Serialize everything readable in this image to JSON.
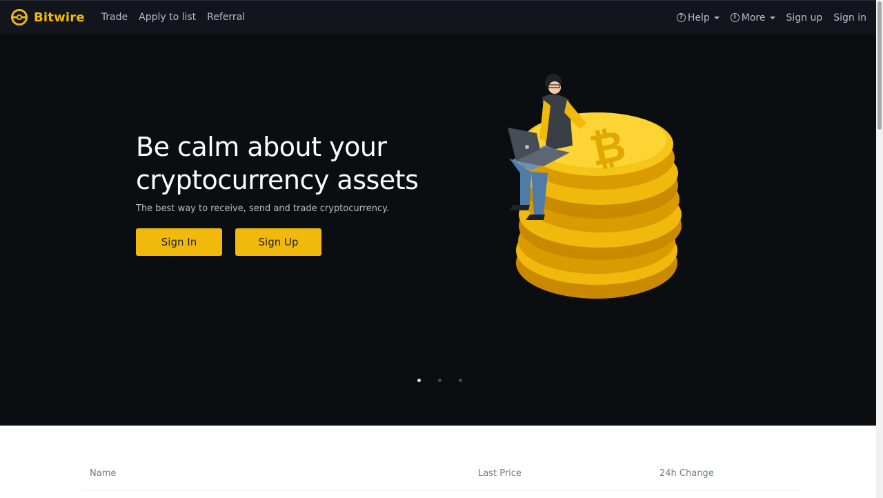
{
  "brand": {
    "name": "Bitwire",
    "accent_color": "#f0b90b"
  },
  "nav": {
    "left": [
      "Trade",
      "Apply to list",
      "Referral"
    ],
    "help": {
      "icon": "question-circle-icon",
      "label": "Help"
    },
    "more": {
      "icon": "info-circle-icon",
      "label": "More"
    },
    "signup": "Sign up",
    "signin": "Sign in"
  },
  "hero": {
    "title": "Be calm about your cryptocurrency assets",
    "subtitle": "The best way to receive, send and trade cryptocurrency.",
    "signin_button": "Sign In",
    "signup_button": "Sign Up",
    "carousel": {
      "slides": 3,
      "active": 1
    }
  },
  "market_table": {
    "columns": [
      "Name",
      "Last Price",
      "24h Change"
    ]
  }
}
